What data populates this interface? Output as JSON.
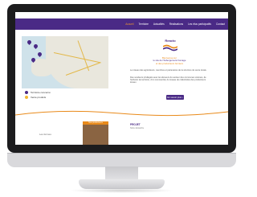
{
  "nav": {
    "items": [
      {
        "label": "Accueil",
        "active": true
      },
      {
        "label": "Territoire",
        "active": false
      },
      {
        "label": "Actualités",
        "active": false
      },
      {
        "label": "Réalisations",
        "active": false
      },
      {
        "label": "Les élus participatifs",
        "active": false
      },
      {
        "label": "Contact",
        "active": false
      }
    ]
  },
  "map": {
    "legend": [
      {
        "label": "Territoire concerné",
        "color": "#4a2a86"
      },
      {
        "label": "Vente produits",
        "color": "#f2b632"
      }
    ]
  },
  "logo": {
    "text": "Reacto"
  },
  "intro": {
    "line1": "Bienvenue sur",
    "line2": "le site de l'hébergement-fromage",
    "line3": "et des producteurs fermiers"
  },
  "para1": "Le réseau des agriculteurs, membres et partenaires de la structure de vente locale.",
  "para2": "Des vendeurs privilégiés avec les éleveurs du secteur des communes voisines, de l'échelon de territoire, d'un commercial, du réseau de collectivités des producteurs locaux.",
  "button": {
    "label": "En savoir plus ›"
  },
  "projet": {
    "title": "PROJET",
    "subtitle": "Notre démarche"
  },
  "photo": {
    "label": "Nos producteurs",
    "caption": "Les fermes"
  },
  "colors": {
    "primary": "#4a2a86",
    "accent": "#e98a1a"
  }
}
